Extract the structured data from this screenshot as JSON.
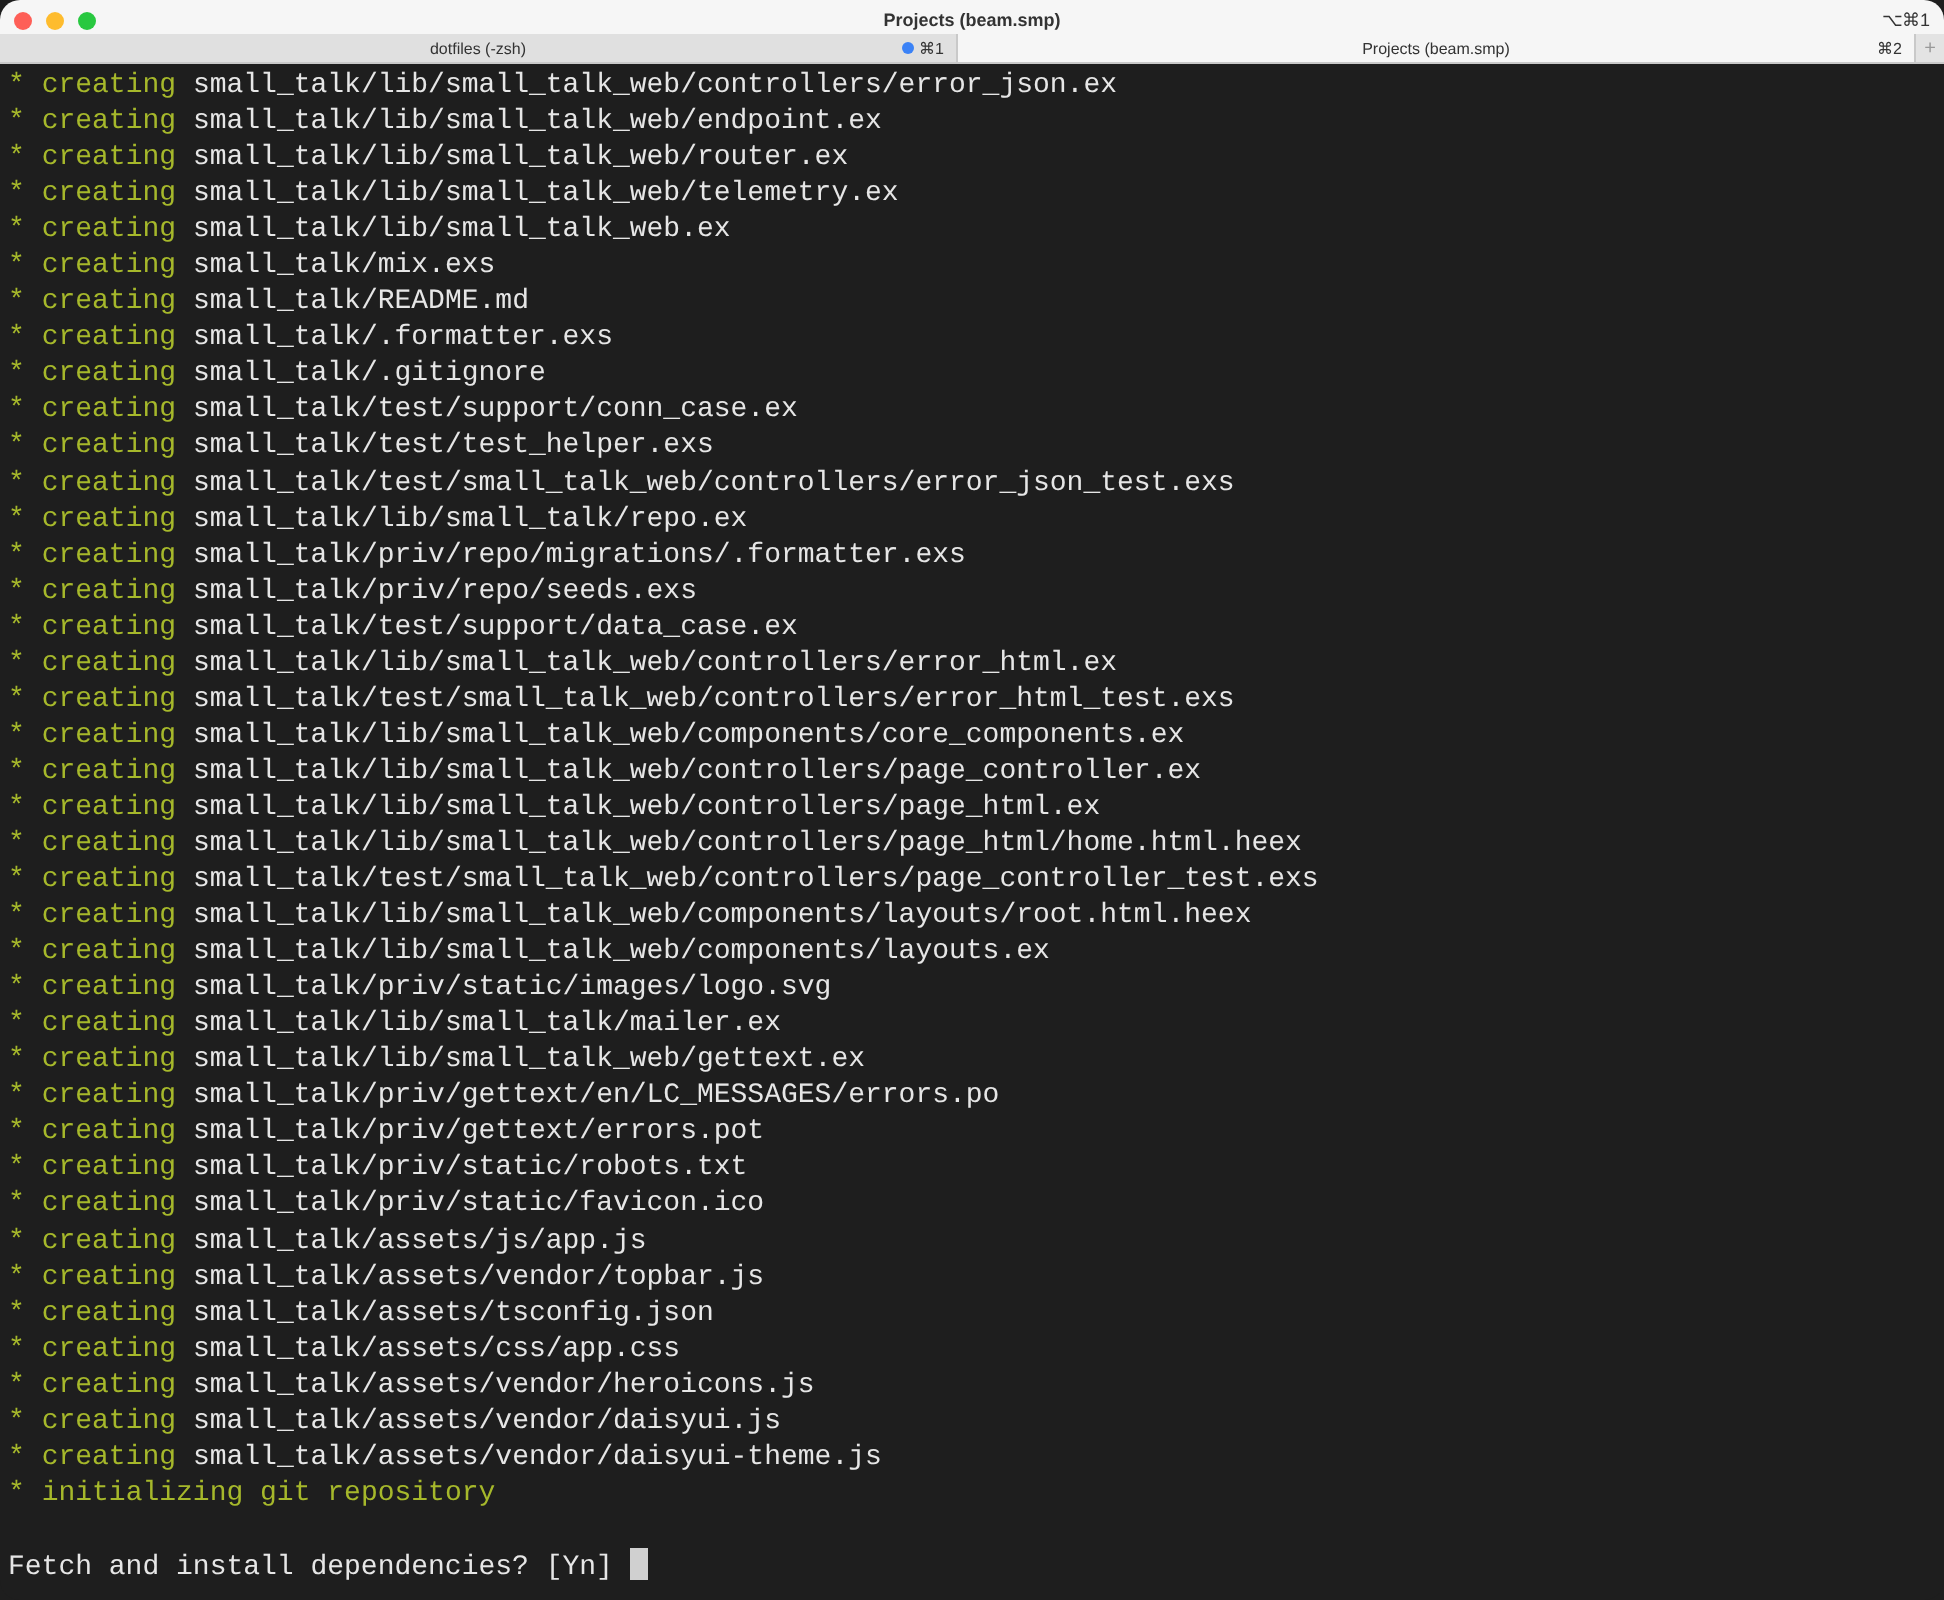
{
  "window": {
    "title": "Projects (beam.smp)",
    "shortcut": "⌥⌘1"
  },
  "tabs": [
    {
      "label": "dotfiles (-zsh)",
      "shortcut": "⌘1",
      "activity": true,
      "selected": false
    },
    {
      "label": "Projects (beam.smp)",
      "shortcut": "⌘2",
      "activity": false,
      "selected": true
    }
  ],
  "new_tab": "+",
  "lines": [
    {
      "marker": "*",
      "verb": "creating",
      "path": "small_talk/lib/small_talk_web/controllers/error_json.ex"
    },
    {
      "marker": "*",
      "verb": "creating",
      "path": "small_talk/lib/small_talk_web/endpoint.ex"
    },
    {
      "marker": "*",
      "verb": "creating",
      "path": "small_talk/lib/small_talk_web/router.ex"
    },
    {
      "marker": "*",
      "verb": "creating",
      "path": "small_talk/lib/small_talk_web/telemetry.ex"
    },
    {
      "marker": "*",
      "verb": "creating",
      "path": "small_talk/lib/small_talk_web.ex"
    },
    {
      "marker": "*",
      "verb": "creating",
      "path": "small_talk/mix.exs"
    },
    {
      "marker": "*",
      "verb": "creating",
      "path": "small_talk/README.md"
    },
    {
      "marker": "*",
      "verb": "creating",
      "path": "small_talk/.formatter.exs"
    },
    {
      "marker": "*",
      "verb": "creating",
      "path": "small_talk/.gitignore"
    },
    {
      "marker": "*",
      "verb": "creating",
      "path": "small_talk/test/support/conn_case.ex"
    },
    {
      "marker": "*",
      "verb": "creating",
      "path": "small_talk/test/test_helper.exs"
    },
    {
      "marker": "*",
      "verb": "creating",
      "path": "small_talk/test/small_talk_web/controllers/error_json_test.exs"
    },
    {
      "marker": "*",
      "verb": "creating",
      "path": "small_talk/lib/small_talk/repo.ex"
    },
    {
      "marker": "*",
      "verb": "creating",
      "path": "small_talk/priv/repo/migrations/.formatter.exs"
    },
    {
      "marker": "*",
      "verb": "creating",
      "path": "small_talk/priv/repo/seeds.exs"
    },
    {
      "marker": "*",
      "verb": "creating",
      "path": "small_talk/test/support/data_case.ex"
    },
    {
      "marker": "*",
      "verb": "creating",
      "path": "small_talk/lib/small_talk_web/controllers/error_html.ex"
    },
    {
      "marker": "*",
      "verb": "creating",
      "path": "small_talk/test/small_talk_web/controllers/error_html_test.exs"
    },
    {
      "marker": "*",
      "verb": "creating",
      "path": "small_talk/lib/small_talk_web/components/core_components.ex"
    },
    {
      "marker": "*",
      "verb": "creating",
      "path": "small_talk/lib/small_talk_web/controllers/page_controller.ex"
    },
    {
      "marker": "*",
      "verb": "creating",
      "path": "small_talk/lib/small_talk_web/controllers/page_html.ex"
    },
    {
      "marker": "*",
      "verb": "creating",
      "path": "small_talk/lib/small_talk_web/controllers/page_html/home.html.heex"
    },
    {
      "marker": "*",
      "verb": "creating",
      "path": "small_talk/test/small_talk_web/controllers/page_controller_test.exs"
    },
    {
      "marker": "*",
      "verb": "creating",
      "path": "small_talk/lib/small_talk_web/components/layouts/root.html.heex"
    },
    {
      "marker": "*",
      "verb": "creating",
      "path": "small_talk/lib/small_talk_web/components/layouts.ex"
    },
    {
      "marker": "*",
      "verb": "creating",
      "path": "small_talk/priv/static/images/logo.svg"
    },
    {
      "marker": "*",
      "verb": "creating",
      "path": "small_talk/lib/small_talk/mailer.ex"
    },
    {
      "marker": "*",
      "verb": "creating",
      "path": "small_talk/lib/small_talk_web/gettext.ex"
    },
    {
      "marker": "*",
      "verb": "creating",
      "path": "small_talk/priv/gettext/en/LC_MESSAGES/errors.po"
    },
    {
      "marker": "*",
      "verb": "creating",
      "path": "small_talk/priv/gettext/errors.pot"
    },
    {
      "marker": "*",
      "verb": "creating",
      "path": "small_talk/priv/static/robots.txt"
    },
    {
      "marker": "*",
      "verb": "creating",
      "path": "small_talk/priv/static/favicon.ico"
    },
    {
      "marker": "*",
      "verb": "creating",
      "path": "small_talk/assets/js/app.js"
    },
    {
      "marker": "*",
      "verb": "creating",
      "path": "small_talk/assets/vendor/topbar.js"
    },
    {
      "marker": "*",
      "verb": "creating",
      "path": "small_talk/assets/tsconfig.json"
    },
    {
      "marker": "*",
      "verb": "creating",
      "path": "small_talk/assets/css/app.css"
    },
    {
      "marker": "*",
      "verb": "creating",
      "path": "small_talk/assets/vendor/heroicons.js"
    },
    {
      "marker": "*",
      "verb": "creating",
      "path": "small_talk/assets/vendor/daisyui.js"
    },
    {
      "marker": "*",
      "verb": "creating",
      "path": "small_talk/assets/vendor/daisyui-theme.js"
    },
    {
      "marker": "*",
      "verb": "initializing git repository"
    }
  ],
  "prompt": "Fetch and install dependencies? [Yn]"
}
